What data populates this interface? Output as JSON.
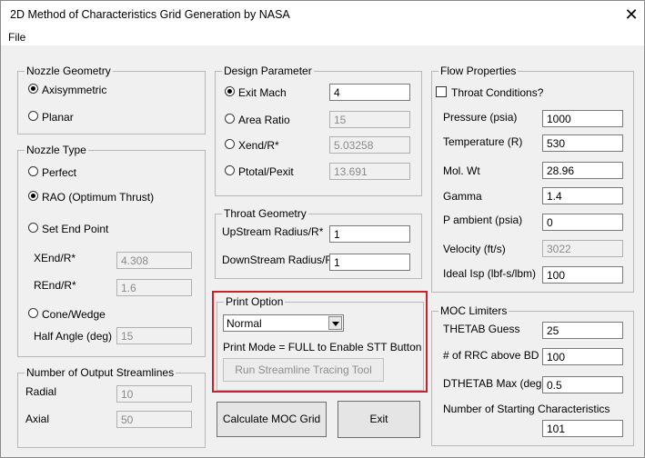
{
  "window": {
    "title": "2D Method of Characteristics Grid Generation by NASA",
    "close_glyph": "✕"
  },
  "menu": {
    "file": "File"
  },
  "nozzle_geometry": {
    "title": "Nozzle Geometry",
    "axisymmetric": "Axisymmetric",
    "planar": "Planar",
    "selected": "Axisymmetric"
  },
  "nozzle_type": {
    "title": "Nozzle Type",
    "perfect": "Perfect",
    "rao": "RAO (Optimum Thrust)",
    "set_end_point": "Set End Point",
    "xend_label": "XEnd/R*",
    "xend_value": "4.308",
    "rend_label": "REnd/R*",
    "rend_value": "1.6",
    "cone": "Cone/Wedge",
    "half_angle_label": "Half Angle (deg)",
    "half_angle_value": "15",
    "selected": "RAO (Optimum Thrust)"
  },
  "output_streamlines": {
    "title": "Number of Output Streamlines",
    "radial_label": "Radial",
    "radial_value": "10",
    "axial_label": "Axial",
    "axial_value": "50"
  },
  "design_parameter": {
    "title": "Design Parameter",
    "exit_mach_label": "Exit Mach",
    "exit_mach_value": "4",
    "area_ratio_label": "Area Ratio",
    "area_ratio_value": "15",
    "xend_label": "Xend/R*",
    "xend_value": "5.03258",
    "ptotal_label": "Ptotal/Pexit",
    "ptotal_value": "13.691",
    "selected": "Exit Mach"
  },
  "throat_geometry": {
    "title": "Throat Geometry",
    "upstream_label": "UpStream Radius/R*",
    "upstream_value": "1",
    "downstream_label": "DownStream Radius/R*",
    "downstream_value": "1"
  },
  "print_option": {
    "title": "Print Option",
    "selected": "Normal",
    "note": "Print Mode = FULL to Enable STT Button",
    "stt_button": "Run Streamline Tracing Tool"
  },
  "buttons": {
    "calculate": "Calculate MOC Grid",
    "exit": "Exit"
  },
  "flow_properties": {
    "title": "Flow Properties",
    "throat_conditions": "Throat Conditions?",
    "pressure_label": "Pressure (psia)",
    "pressure_value": "1000",
    "temperature_label": "Temperature (R)",
    "temperature_value": "530",
    "molwt_label": "Mol. Wt",
    "molwt_value": "28.96",
    "gamma_label": "Gamma",
    "gamma_value": "1.4",
    "pambient_label": "P ambient (psia)",
    "pambient_value": "0",
    "velocity_label": "Velocity (ft/s)",
    "velocity_value": "3022",
    "isp_label": "Ideal Isp (lbf-s/lbm)",
    "isp_value": "100"
  },
  "moc_limiters": {
    "title": "MOC Limiters",
    "thetab_label": "THETAB Guess",
    "thetab_value": "25",
    "rrc_label": "# of RRC above BD",
    "rrc_value": "100",
    "dthetab_label": "DTHETAB Max (deg)",
    "dthetab_value": "0.5",
    "nchar_label": "Number of Starting Characteristics",
    "nchar_value": "101"
  }
}
